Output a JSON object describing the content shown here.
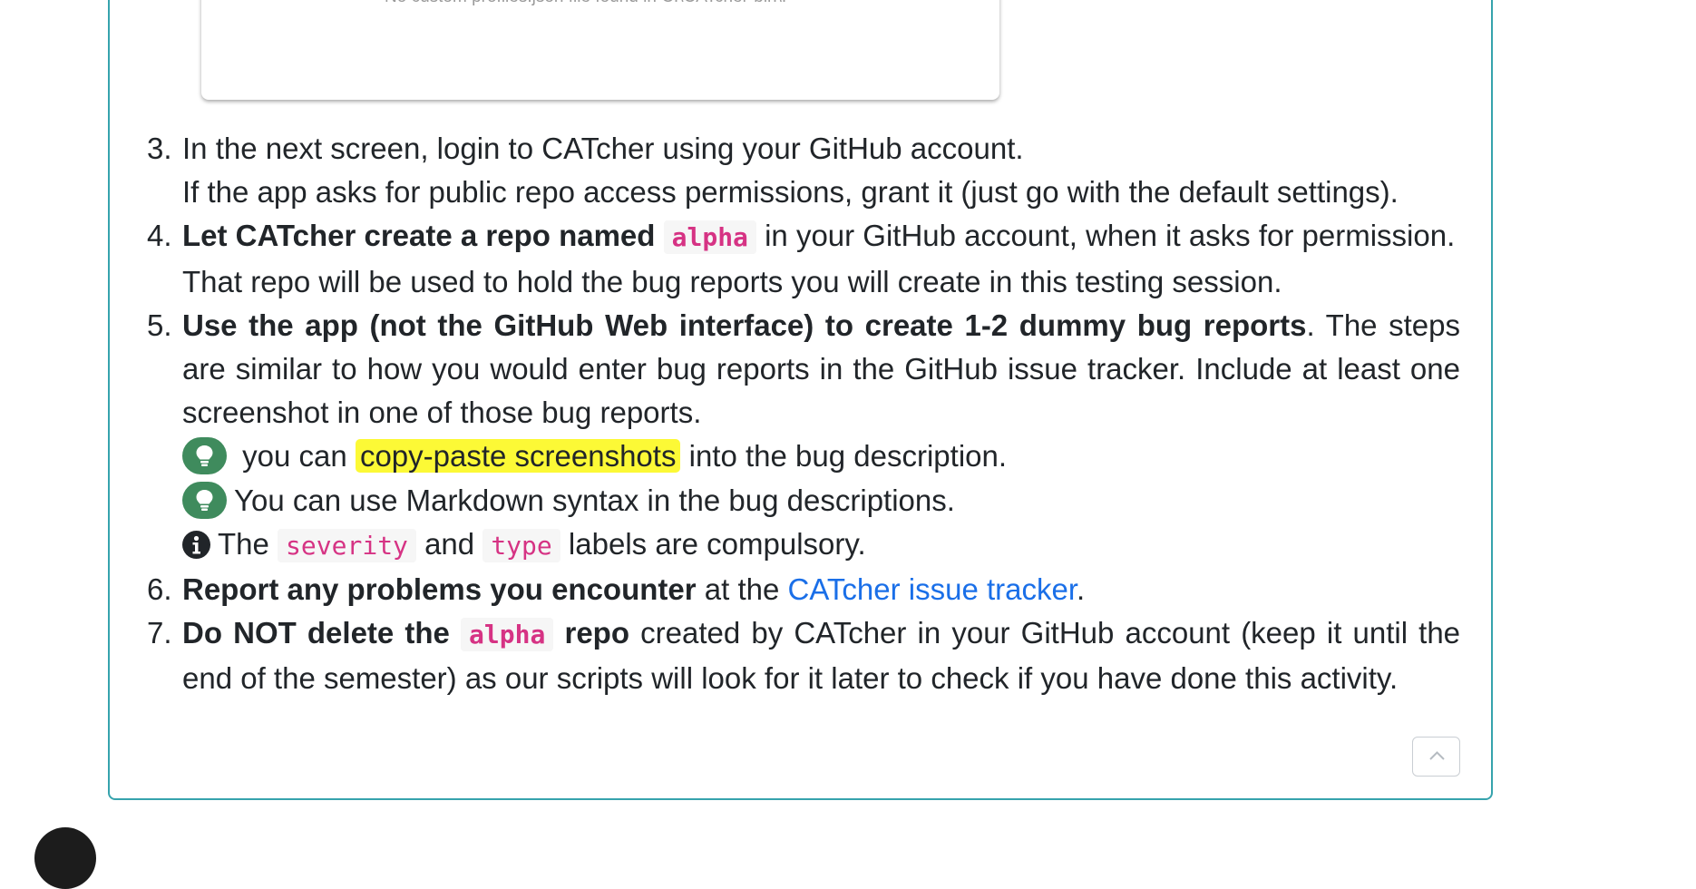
{
  "embedded_screenshot": {
    "caption": "No custom profiles.json file found in C:\\CATcher-bin\\."
  },
  "steps": [
    {
      "number": "3.",
      "line1": "In the next screen, login to CATcher using your GitHub account.",
      "line2": "If the app asks for public repo access permissions, grant it (just go with the default settings)."
    },
    {
      "number": "4.",
      "bold": "Let CATcher create a repo named",
      "code": "alpha",
      "rest": "in your GitHub account, when it asks for permission.",
      "line2": "That repo will be used to hold the bug reports you will create in this testing session."
    },
    {
      "number": "5.",
      "bold": "Use the app (not the GitHub Web interface) to create 1-2 dummy bug reports",
      "rest": ". The steps are similar to how you would enter bug reports in the GitHub issue tracker. Include at least one screenshot in one of those bug reports.",
      "tip1_pre": "you can",
      "tip1_highlight": "copy-paste screenshots",
      "tip1_post": "into the bug description.",
      "tip2": "You can use Markdown syntax in the bug descriptions.",
      "info_pre": "The",
      "info_code1": "severity",
      "info_mid": "and",
      "info_code2": "type",
      "info_post": "labels are compulsory."
    },
    {
      "number": "6.",
      "bold": "Report any problems you encounter",
      "mid": "at the",
      "link": "CATcher issue tracker",
      "end": "."
    },
    {
      "number": "7.",
      "bold_pre": "Do NOT delete the",
      "code": "alpha",
      "bold_post": "repo",
      "rest": "created by CATcher in your GitHub account (keep it until the end of the semester) as our scripts will look for it later to check if you have done this activity."
    }
  ],
  "icons": {
    "tip": "lightbulb-icon",
    "info": "info-circle-icon",
    "back_to_top": "chevron-up-icon"
  },
  "colors": {
    "panel_border": "#36a3ad",
    "code_text": "#d63384",
    "link": "#1a6fe8",
    "highlight": "#fcf936",
    "tip_badge": "#3f8b5d"
  }
}
